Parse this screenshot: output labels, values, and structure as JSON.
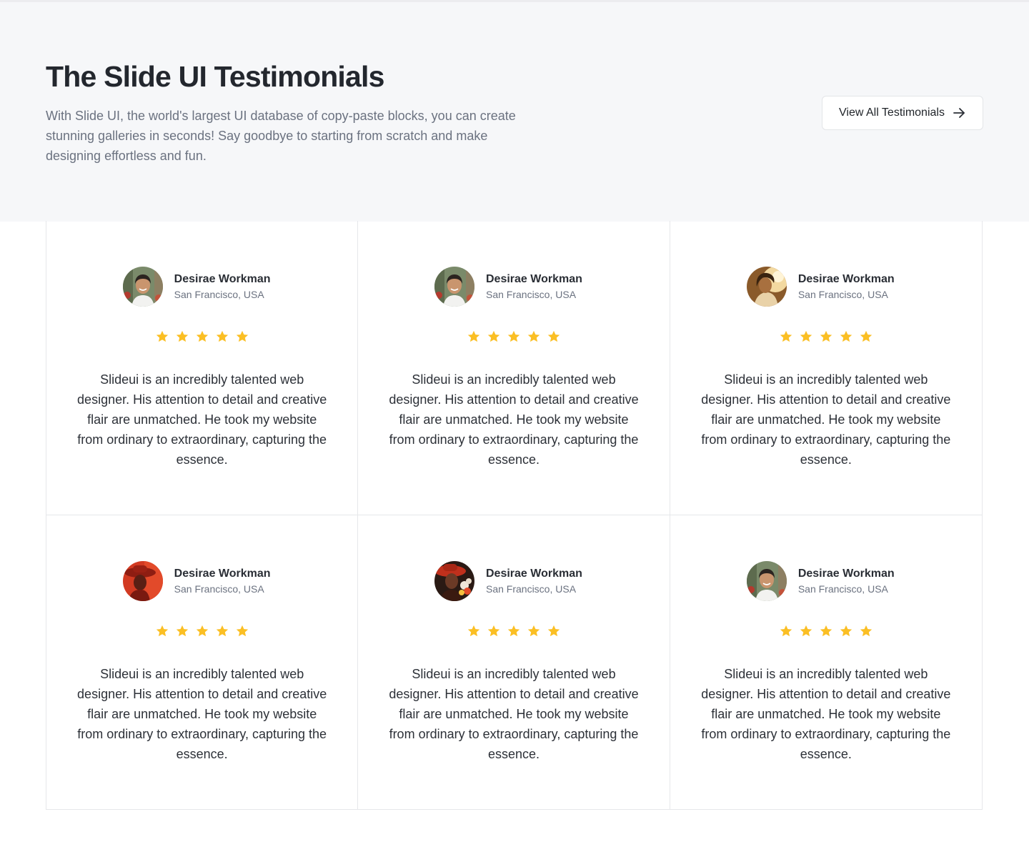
{
  "header": {
    "title": "The Slide UI Testimonials",
    "description": "With Slide UI, the world's largest UI database of copy-paste blocks, you can create stunning galleries in seconds! Say goodbye to starting from scratch and make designing effortless and fun.",
    "button_label": "View All Testimonials",
    "button_icon": "arrow-right-icon"
  },
  "colors": {
    "star": "#fbbf24",
    "hero_bg": "#f6f7f9",
    "border": "#e6e7ea"
  },
  "testimonials": [
    {
      "name": "Desirae Workman",
      "location": "San Francisco, USA",
      "rating": 5,
      "avatar": "avatar-smiling-person-outdoor",
      "quote": "Slideui is an incredibly talented web designer. His attention to detail and creative flair are unmatched. He took my website from ordinary to extraordinary, capturing the essence."
    },
    {
      "name": "Desirae Workman",
      "location": "San Francisco, USA",
      "rating": 5,
      "avatar": "avatar-smiling-person-outdoor",
      "quote": "Slideui is an incredibly talented web designer. His attention to detail and creative flair are unmatched. He took my website from ordinary to extraordinary, capturing the essence."
    },
    {
      "name": "Desirae Workman",
      "location": "San Francisco, USA",
      "rating": 5,
      "avatar": "avatar-person-sunlight",
      "quote": "Slideui is an incredibly talented web designer. His attention to detail and creative flair are unmatched. He took my website from ordinary to extraordinary, capturing the essence."
    },
    {
      "name": "Desirae Workman",
      "location": "San Francisco, USA",
      "rating": 5,
      "avatar": "avatar-woman-red-hat",
      "quote": "Slideui is an incredibly talented web designer. His attention to detail and creative flair are unmatched. He took my website from ordinary to extraordinary, capturing the essence."
    },
    {
      "name": "Desirae Workman",
      "location": "San Francisco, USA",
      "rating": 5,
      "avatar": "avatar-woman-red-hat-flowers",
      "quote": "Slideui is an incredibly talented web designer. His attention to detail and creative flair are unmatched. He took my website from ordinary to extraordinary, capturing the essence."
    },
    {
      "name": "Desirae Workman",
      "location": "San Francisco, USA",
      "rating": 5,
      "avatar": "avatar-smiling-person-outdoor",
      "quote": "Slideui is an incredibly talented web designer. His attention to detail and creative flair are unmatched. He took my website from ordinary to extraordinary, capturing the essence."
    }
  ]
}
